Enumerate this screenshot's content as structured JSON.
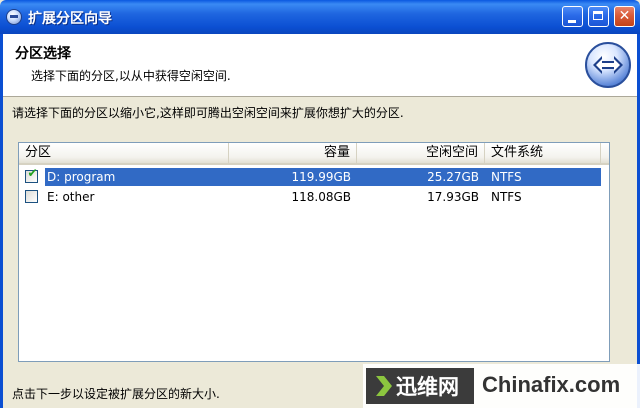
{
  "window": {
    "title": "扩展分区向导"
  },
  "header": {
    "title": "分区选择",
    "subtitle": "选择下面的分区,以从中获得空闲空间."
  },
  "instruction": "请选择下面的分区以缩小它,这样即可腾出空闲空间来扩展你想扩大的分区.",
  "table": {
    "columns": [
      "分区",
      "容量",
      "空闲空间",
      "文件系统"
    ],
    "rows": [
      {
        "checked": true,
        "name": "D: program",
        "capacity": "119.99GB",
        "free": "25.27GB",
        "fs": "NTFS",
        "selected": true
      },
      {
        "checked": false,
        "name": "E: other",
        "capacity": "118.08GB",
        "free": "17.93GB",
        "fs": "NTFS",
        "selected": false
      }
    ]
  },
  "footer": "点击下一步以设定被扩展分区的新大小.",
  "watermark": {
    "brand": "迅维网",
    "site": "Chinafix.com"
  },
  "colors": {
    "titlebar": "#0b4fd2",
    "selection": "#316ac5",
    "close": "#c44318"
  },
  "icons": [
    "app-disk-icon",
    "minimize-icon",
    "maximize-icon",
    "close-icon",
    "expand-arrows-icon",
    "checkbox-checked-icon",
    "checkbox-empty-icon"
  ]
}
